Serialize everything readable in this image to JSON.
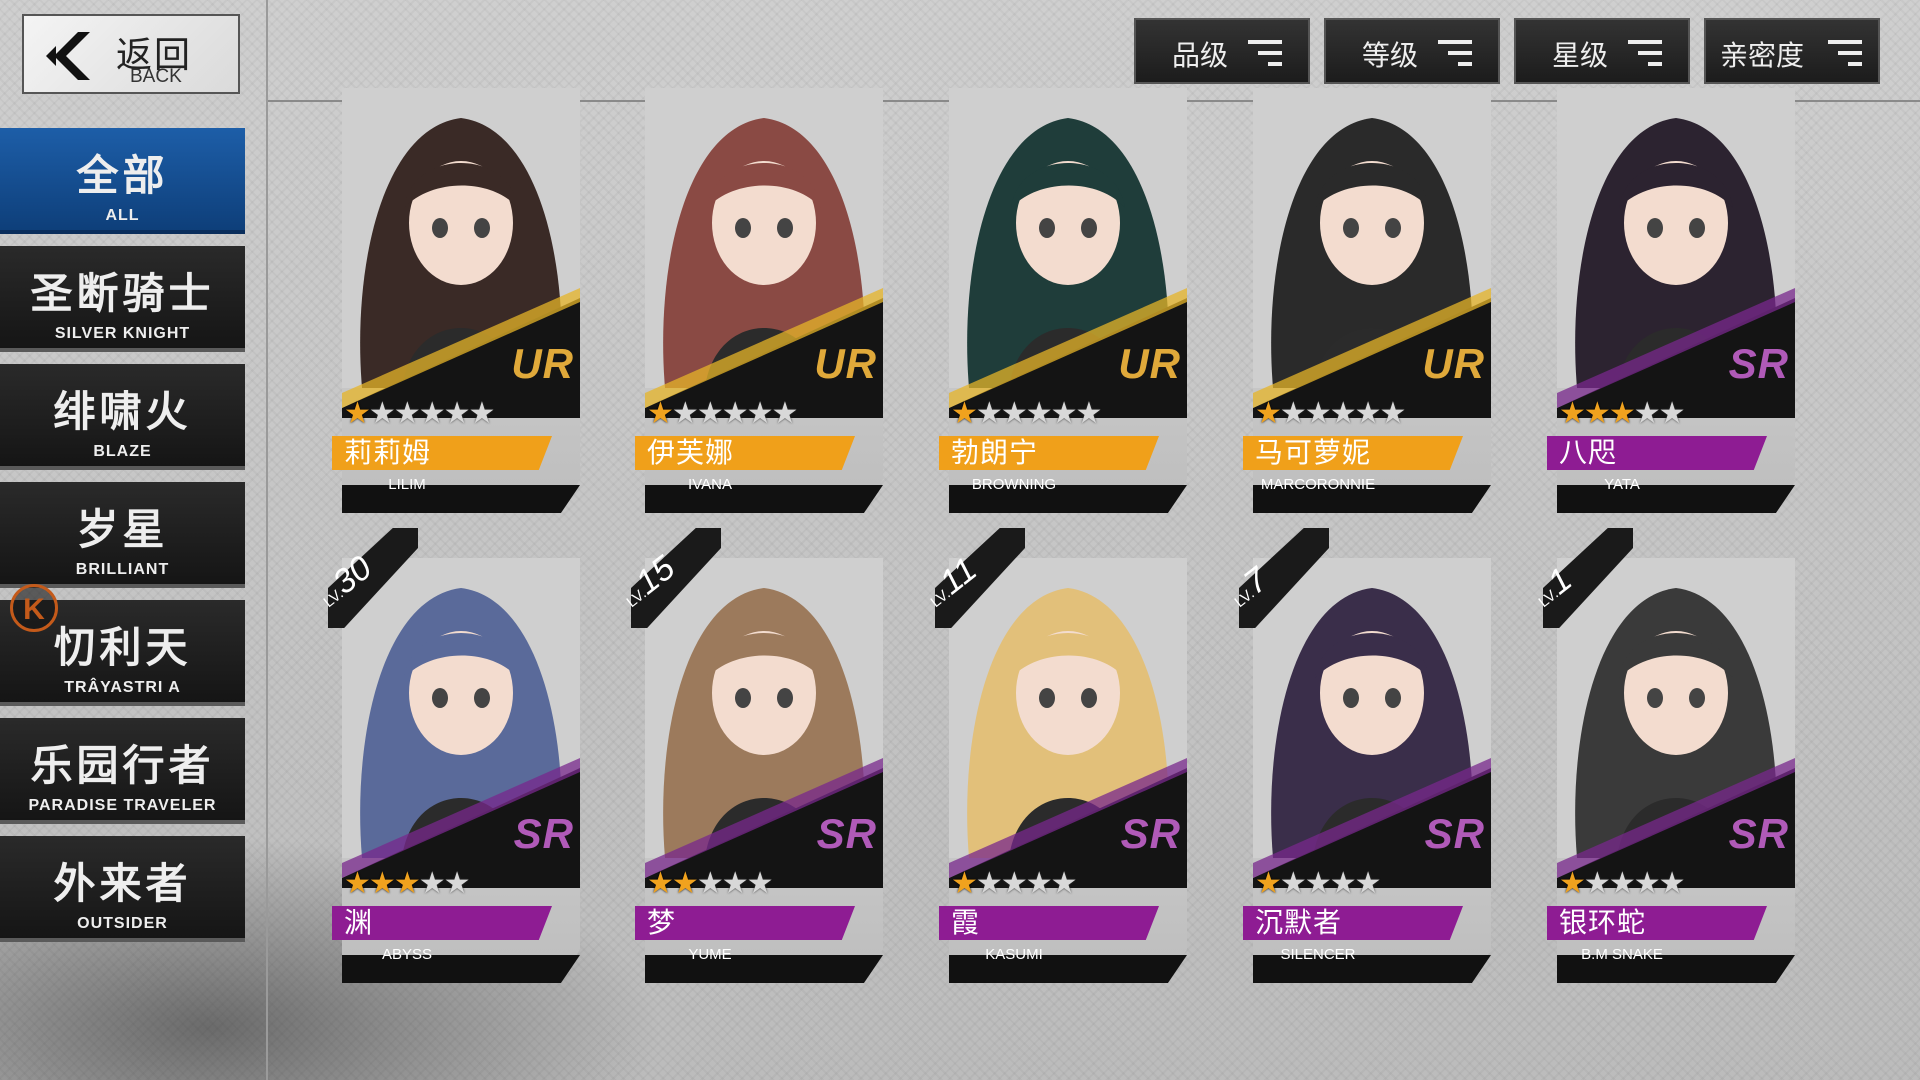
{
  "back": {
    "zh": "返回",
    "en": "BACK"
  },
  "sidebar": {
    "items": [
      {
        "zh": "全部",
        "en": "ALL",
        "active": true
      },
      {
        "zh": "圣断骑士",
        "en": "SILVER KNIGHT",
        "active": false
      },
      {
        "zh": "绯啸火",
        "en": "BLAZE",
        "active": false
      },
      {
        "zh": "岁星",
        "en": "BRILLIANT",
        "active": false
      },
      {
        "zh": "忉利天",
        "en": "TRÂYASTRI A",
        "active": false
      },
      {
        "zh": "乐园行者",
        "en": "PARADISE TRAVELER",
        "active": false
      },
      {
        "zh": "外来者",
        "en": "OUTSIDER",
        "active": false
      }
    ],
    "badge": "K"
  },
  "sort_buttons": [
    {
      "label": "品级"
    },
    {
      "label": "等级"
    },
    {
      "label": "星级"
    },
    {
      "label": "亲密度"
    }
  ],
  "lv_prefix": "LV.",
  "cards": [
    {
      "zh": "莉莉姆",
      "en": "LILIM",
      "rarity": "UR",
      "stars": 1,
      "max_stars": 6,
      "level": null,
      "hair": "#3a2a26",
      "accent": "#c8a24a"
    },
    {
      "zh": "伊芙娜",
      "en": "IVANA",
      "rarity": "UR",
      "stars": 1,
      "max_stars": 6,
      "level": null,
      "hair": "#8a4a44",
      "accent": "#c8a24a"
    },
    {
      "zh": "勃朗宁",
      "en": "BROWNING",
      "rarity": "UR",
      "stars": 1,
      "max_stars": 6,
      "level": null,
      "hair": "#1f3d3a",
      "accent": "#c8a24a"
    },
    {
      "zh": "马可萝妮",
      "en": "MARCORONNIE",
      "rarity": "UR",
      "stars": 1,
      "max_stars": 6,
      "level": null,
      "hair": "#2a2a2a",
      "accent": "#c8a24a"
    },
    {
      "zh": "八咫",
      "en": "YATA",
      "rarity": "SR",
      "stars": 3,
      "max_stars": 5,
      "level": null,
      "hair": "#2c2330",
      "accent": "#7a3f8f"
    },
    {
      "zh": "渊",
      "en": "ABYSS",
      "rarity": "SR",
      "stars": 3,
      "max_stars": 5,
      "level": "30",
      "hair": "#5a6a9a",
      "accent": "#7a3f8f"
    },
    {
      "zh": "梦",
      "en": "YUME",
      "rarity": "SR",
      "stars": 2,
      "max_stars": 5,
      "level": "15",
      "hair": "#9c7a5c",
      "accent": "#7a3f8f"
    },
    {
      "zh": "霞",
      "en": "KASUMI",
      "rarity": "SR",
      "stars": 1,
      "max_stars": 5,
      "level": "11",
      "hair": "#e2c07a",
      "accent": "#7a3f8f"
    },
    {
      "zh": "沉默者",
      "en": "SILENCER",
      "rarity": "SR",
      "stars": 1,
      "max_stars": 5,
      "level": "7",
      "hair": "#3a2e4a",
      "accent": "#7a3f8f"
    },
    {
      "zh": "银环蛇",
      "en": "B.M SNAKE",
      "rarity": "SR",
      "stars": 1,
      "max_stars": 5,
      "level": "1",
      "hair": "#3a3a3a",
      "accent": "#7a3f8f"
    }
  ],
  "colors": {
    "ur_name_bar": "#f0a01a",
    "sr_name_bar": "#8e1c93",
    "ur_text": "#e0a93a",
    "sr_text": "#b05ab8",
    "sidebar_active": "#1d5ea8"
  }
}
